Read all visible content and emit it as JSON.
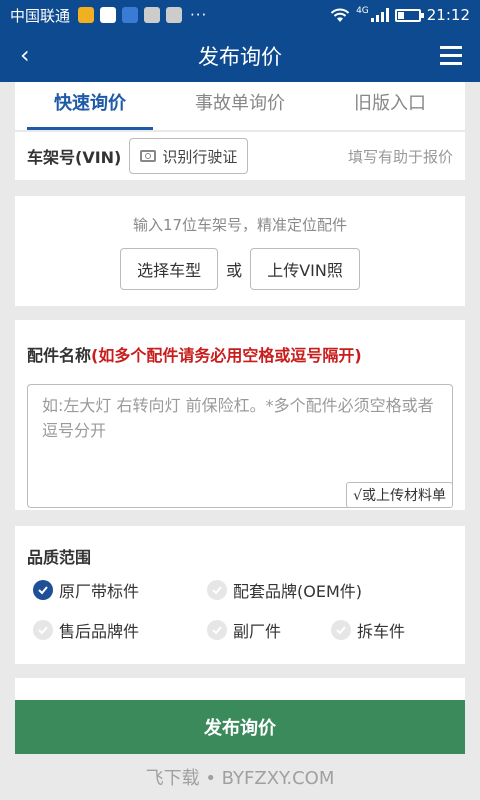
{
  "status_bar": {
    "carrier": "中国联通",
    "more": "···",
    "network": "4G",
    "time": "21:12",
    "notification_colors": [
      "#f0b020",
      "#ffffff",
      "#3a7bd5",
      "#cccccc",
      "#cccccc"
    ]
  },
  "nav": {
    "back_icon": "chevron-left-icon",
    "title": "发布询价",
    "menu_icon": "hamburger-menu-icon"
  },
  "tabs": [
    {
      "label": "快速询价",
      "active": true
    },
    {
      "label": "事故单询价",
      "active": false
    },
    {
      "label": "旧版入口",
      "active": false
    }
  ],
  "vin": {
    "label": "车架号(VIN)",
    "ocr_button": "识别行驶证",
    "hint": "填写有助于报价",
    "input_placeholder": "输入17位车架号，精准定位配件",
    "select_model_button": "选择车型",
    "or_text": "或",
    "upload_vin_button": "上传VIN照"
  },
  "parts": {
    "label": "配件名称",
    "note": "(如多个配件请务必用空格或逗号隔开)",
    "placeholder": "如:左大灯 右转向灯 前保险杠。*多个配件必须空格或者逗号分开",
    "upload_button": "√或上传材料单"
  },
  "quality": {
    "title": "品质范围",
    "options": [
      {
        "label": "原厂带标件",
        "checked": true
      },
      {
        "label": "配套品牌(OEM件)",
        "checked": false
      },
      {
        "label": "售后品牌件",
        "checked": false
      },
      {
        "label": "副厂件",
        "checked": false
      },
      {
        "label": "拆车件",
        "checked": false
      }
    ]
  },
  "submit_button": "发布询价",
  "watermark": "飞下载 • BYFZXY.COM",
  "colors": {
    "header_bg": "#0d4a8f",
    "tab_active": "#1e5aa8",
    "note_red": "#c91d1d",
    "submit_bg": "#3b8a5c",
    "check_on": "#1e4f97"
  }
}
